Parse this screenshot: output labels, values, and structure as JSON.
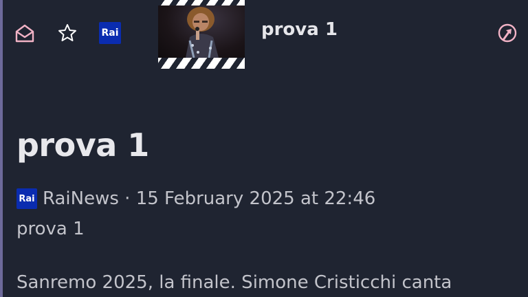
{
  "header": {
    "title": "prova 1",
    "rai_logo_text": "Rai",
    "icons": {
      "envelope": "envelope-open-icon",
      "star": "star-icon",
      "rai": "rai-logo",
      "share": "share-pin-icon"
    }
  },
  "article": {
    "title": "prova 1",
    "source_logo_text": "Rai",
    "source": "RaiNews",
    "separator": " · ",
    "date": "15 February 2025 at 22:46",
    "summary": "prova 1",
    "body_first_line": "Sanremo 2025, la finale. Simone Cristicchi canta"
  },
  "colors": {
    "background": "#1f2431",
    "accent_pink": "#f2b3c6",
    "rai_blue": "#0a2cb0",
    "left_border": "#6d6a9a"
  }
}
